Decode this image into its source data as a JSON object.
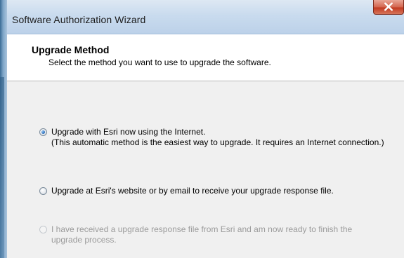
{
  "window": {
    "title": "Software Authorization Wizard",
    "close_icon": "close-x-icon",
    "close_button_color": "#c23a21"
  },
  "header": {
    "title": "Upgrade Method",
    "subtitle": "Select the method you want to use to upgrade the software."
  },
  "options": [
    {
      "line1": "Upgrade with Esri now using the Internet.",
      "line2": "(This automatic method is the easiest way to upgrade. It requires an Internet connection.)",
      "checked": true,
      "enabled": true
    },
    {
      "line1": "Upgrade at Esri's website or by email to receive your upgrade response file.",
      "checked": false,
      "enabled": true
    },
    {
      "line1": "I have received a upgrade response file from Esri and am now ready to finish the",
      "line2": "upgrade process.",
      "checked": false,
      "enabled": false
    }
  ]
}
